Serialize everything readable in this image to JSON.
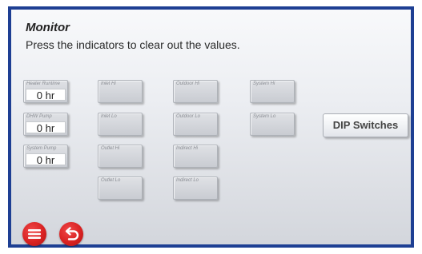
{
  "header": {
    "title": "Monitor",
    "instruction": "Press the indicators to clear out the values."
  },
  "indicators": [
    {
      "label": "Heater Runtime",
      "value": "0 hr"
    },
    {
      "label": "Inlet Hi",
      "value": ""
    },
    {
      "label": "Outdoor Hi",
      "value": ""
    },
    {
      "label": "System Hi",
      "value": ""
    },
    {
      "label": "DHW Pump",
      "value": "0 hr"
    },
    {
      "label": "Inlet Lo",
      "value": ""
    },
    {
      "label": "Outdoor Lo",
      "value": ""
    },
    {
      "label": "System Lo",
      "value": ""
    },
    {
      "label": "System Pump",
      "value": "0 hr"
    },
    {
      "label": "Outlet Hi",
      "value": ""
    },
    {
      "label": "Indirect Hi",
      "value": ""
    },
    {
      "label": "Outlet Lo",
      "value": ""
    },
    {
      "label": "Indirect Lo",
      "value": ""
    }
  ],
  "buttons": {
    "dip_switches": "DIP Switches"
  },
  "footer": {
    "menu_icon": "menu-icon",
    "back_icon": "back-arrow-icon"
  },
  "colors": {
    "frame_border": "#1e3f93",
    "footer_button": "#d92222"
  }
}
